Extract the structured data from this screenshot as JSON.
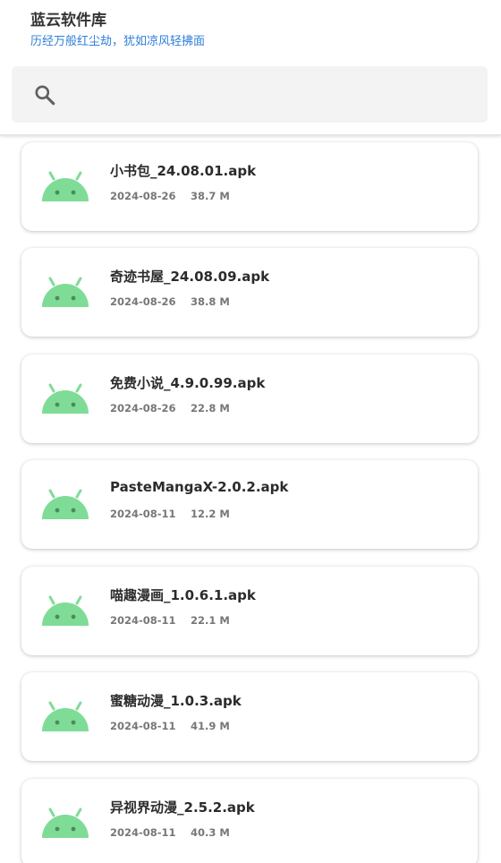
{
  "header": {
    "title": "蓝云软件库",
    "subtitle": "历经万般红尘劫，犹如凉风轻拂面"
  },
  "search": {
    "icon": "search-icon",
    "placeholder": "",
    "value": ""
  },
  "colors": {
    "accent": "#2f7fd8",
    "android_green": "#7fdc97",
    "background": "#ffffff",
    "search_bg": "#f3f3f3"
  },
  "files": [
    {
      "name": "小书包_24.08.01.apk",
      "date": "2024-08-26",
      "size": "38.7 M",
      "icon": "android-icon"
    },
    {
      "name": "奇迹书屋_24.08.09.apk",
      "date": "2024-08-26",
      "size": "38.8 M",
      "icon": "android-icon"
    },
    {
      "name": "免费小说_4.9.0.99.apk",
      "date": "2024-08-26",
      "size": "22.8 M",
      "icon": "android-icon"
    },
    {
      "name": "PasteMangaX-2.0.2.apk",
      "date": "2024-08-11",
      "size": "12.2 M",
      "icon": "android-icon"
    },
    {
      "name": "喵趣漫画_1.0.6.1.apk",
      "date": "2024-08-11",
      "size": "22.1 M",
      "icon": "android-icon"
    },
    {
      "name": "蜜糖动漫_1.0.3.apk",
      "date": "2024-08-11",
      "size": "41.9 M",
      "icon": "android-icon"
    },
    {
      "name": "异视界动漫_2.5.2.apk",
      "date": "2024-08-11",
      "size": "40.3 M",
      "icon": "android-icon"
    }
  ]
}
